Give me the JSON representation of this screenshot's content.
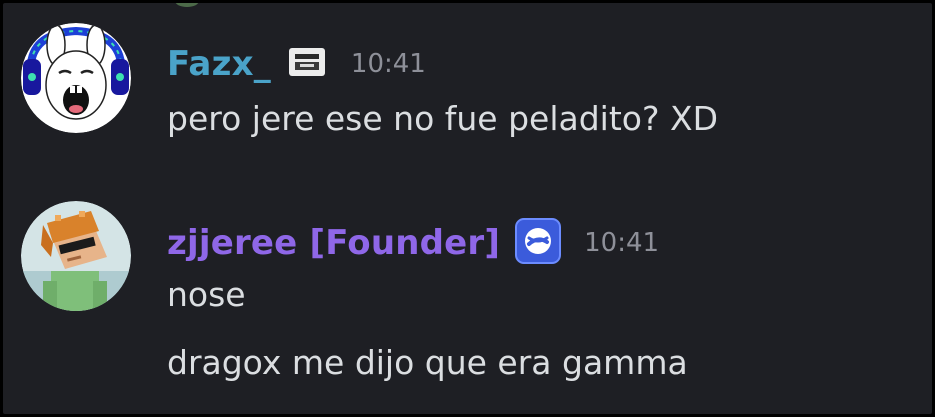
{
  "colors": {
    "background": "#1e1f24",
    "text": "#dbdee1",
    "timestamp": "#8e9099",
    "user1_name": "#4aa3c9",
    "user2_name": "#8f67e8",
    "badge_blue": "#3b5bdb"
  },
  "messages": [
    {
      "username": "Fazx_",
      "timestamp": "10:41",
      "avatar_icon": "bunny-headphones-avatar",
      "badge_icon": "server-tag-icon",
      "lines": [
        "pero jere ese no fue peladito? XD"
      ]
    },
    {
      "username": "zjjeree [Founder]",
      "timestamp": "10:41",
      "avatar_icon": "minecraft-skin-avatar",
      "badge_icon": "boost-badge-icon",
      "lines": [
        "nose",
        "dragox me dijo que era gamma"
      ]
    }
  ]
}
